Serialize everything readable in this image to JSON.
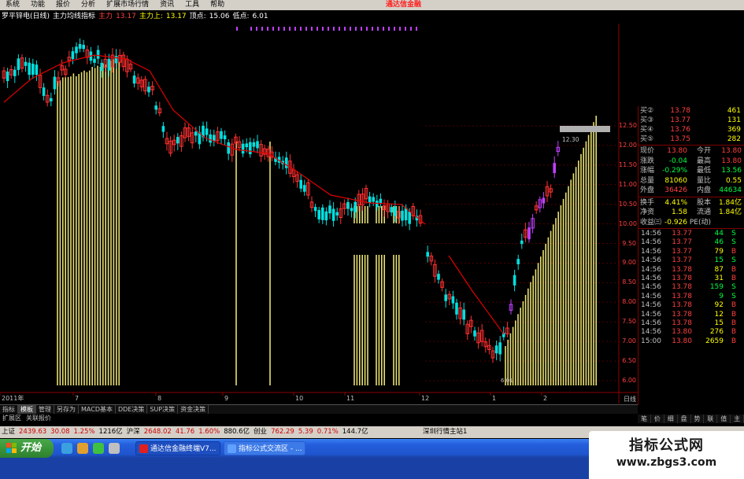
{
  "menu": {
    "items": [
      "系统",
      "功能",
      "报价",
      "分析",
      "扩展市场行情",
      "资讯",
      "工具",
      "帮助"
    ],
    "brand": "通达信金融"
  },
  "infoline": {
    "stock": "罗平锌电(日线)",
    "indicator": "主力均线指标",
    "main_label": "主力",
    "main_value": "13.17",
    "main_up_label": "主力上:",
    "main_up_value": "13.17",
    "top_label": "顶点:",
    "top_value": "15.06",
    "low_label": "低点:",
    "low_value": "6.01"
  },
  "chart_data": {
    "type": "candlestick",
    "price_axis_ticks": [
      "12.50",
      "12.00",
      "11.50",
      "11.00",
      "10.50",
      "10.00",
      "9.50",
      "9.00",
      "8.50",
      "8.00",
      "7.50",
      "7.00",
      "6.50",
      "6.00"
    ],
    "date_labels": [
      "2011年",
      "7",
      "8",
      "9",
      "10",
      "11",
      "12",
      "1",
      "2"
    ],
    "cursor_label": "12.30",
    "low_marker": "6.01",
    "colors": {
      "up": "#ff3030",
      "down": "#00e0e0",
      "ma": "#e00000",
      "volume_bar": "#e8e070",
      "accent": "#c040ff"
    }
  },
  "quotes": {
    "book": [
      {
        "label": "买②",
        "price": "13.78",
        "vol": "461"
      },
      {
        "label": "买③",
        "price": "13.77",
        "vol": "131"
      },
      {
        "label": "买④",
        "price": "13.76",
        "vol": "369"
      },
      {
        "label": "买⑤",
        "price": "13.75",
        "vol": "282"
      }
    ],
    "stats": [
      {
        "l1": "现价",
        "v1": "13.80",
        "c1": "red",
        "l2": "今开",
        "v2": "13.80",
        "c2": "red"
      },
      {
        "l1": "涨跌",
        "v1": "-0.04",
        "c1": "grn",
        "l2": "最高",
        "v2": "13.80",
        "c2": "red"
      },
      {
        "l1": "涨幅",
        "v1": "-0.29%",
        "c1": "grn",
        "l2": "最低",
        "v2": "13.56",
        "c2": "grn"
      },
      {
        "l1": "总量",
        "v1": "81060",
        "c1": "yel",
        "l2": "量比",
        "v2": "0.55",
        "c2": "yel"
      },
      {
        "l1": "外盘",
        "v1": "36426",
        "c1": "red",
        "l2": "内盘",
        "v2": "44634",
        "c2": "grn"
      }
    ],
    "stats2": [
      {
        "l1": "换手",
        "v1": "4.41%",
        "c1": "yel",
        "l2": "股本",
        "v2": "1.84亿",
        "c2": "yel"
      },
      {
        "l1": "净资",
        "v1": "1.58",
        "c1": "yel",
        "l2": "流通",
        "v2": "1.84亿",
        "c2": "yel"
      },
      {
        "l1": "收益㈢",
        "v1": "-0.926",
        "c1": "yel",
        "l2": "PE(动)",
        "v2": "",
        "c2": "yel"
      }
    ],
    "ticks": [
      {
        "time": "14:56",
        "price": "13.77",
        "vol": "44",
        "bs": "S"
      },
      {
        "time": "14:56",
        "price": "13.77",
        "vol": "46",
        "bs": "S"
      },
      {
        "time": "14:56",
        "price": "13.77",
        "vol": "79",
        "bs": "B"
      },
      {
        "time": "14:56",
        "price": "13.77",
        "vol": "15",
        "bs": "S"
      },
      {
        "time": "14:56",
        "price": "13.78",
        "vol": "87",
        "bs": "B"
      },
      {
        "time": "14:56",
        "price": "13.78",
        "vol": "31",
        "bs": "B"
      },
      {
        "time": "14:56",
        "price": "13.78",
        "vol": "159",
        "bs": "S"
      },
      {
        "time": "14:56",
        "price": "13.78",
        "vol": "9",
        "bs": "S"
      },
      {
        "time": "14:56",
        "price": "13.78",
        "vol": "92",
        "bs": "B"
      },
      {
        "time": "14:56",
        "price": "13.78",
        "vol": "12",
        "bs": "B"
      },
      {
        "time": "14:56",
        "price": "13.78",
        "vol": "15",
        "bs": "B"
      },
      {
        "time": "14:56",
        "price": "13.80",
        "vol": "276",
        "bs": "B"
      },
      {
        "time": "15:00",
        "price": "13.80",
        "vol": "2659",
        "bs": "B"
      }
    ],
    "side_label": "日线"
  },
  "tabs": {
    "row1": [
      "指标",
      "模板",
      "管理",
      "另存为",
      "MACD基本",
      "DDE决策",
      "SUP决策",
      "资金决策"
    ],
    "row2": [
      "扩展区",
      "关联报价"
    ],
    "right": [
      "笔",
      "价",
      "细",
      "盘",
      "势",
      "联",
      "值",
      "主"
    ]
  },
  "status": {
    "sh_label": "上证",
    "sh_value": "2439.63",
    "sh_change": "30.08",
    "sh_pct": "1.25%",
    "sh_amount": "1216亿",
    "sz_label": "沪深",
    "sz_value": "2648.02",
    "sz_change": "41.76",
    "sz_pct": "1.60%",
    "sz_amount": "880.6亿",
    "cy_label": "创业",
    "cy_value": "762.29",
    "cy_change": "5.39",
    "cy_pct": "0.71%",
    "cy_amount": "144.7亿",
    "right_text": "深圳行情主站1"
  },
  "taskbar": {
    "start": "开始",
    "items": [
      "通达信金融终端V7...",
      "指标公式交流区 - ..."
    ]
  },
  "watermark": {
    "title": "指标公式网",
    "url": "www.zbgs3.com"
  }
}
